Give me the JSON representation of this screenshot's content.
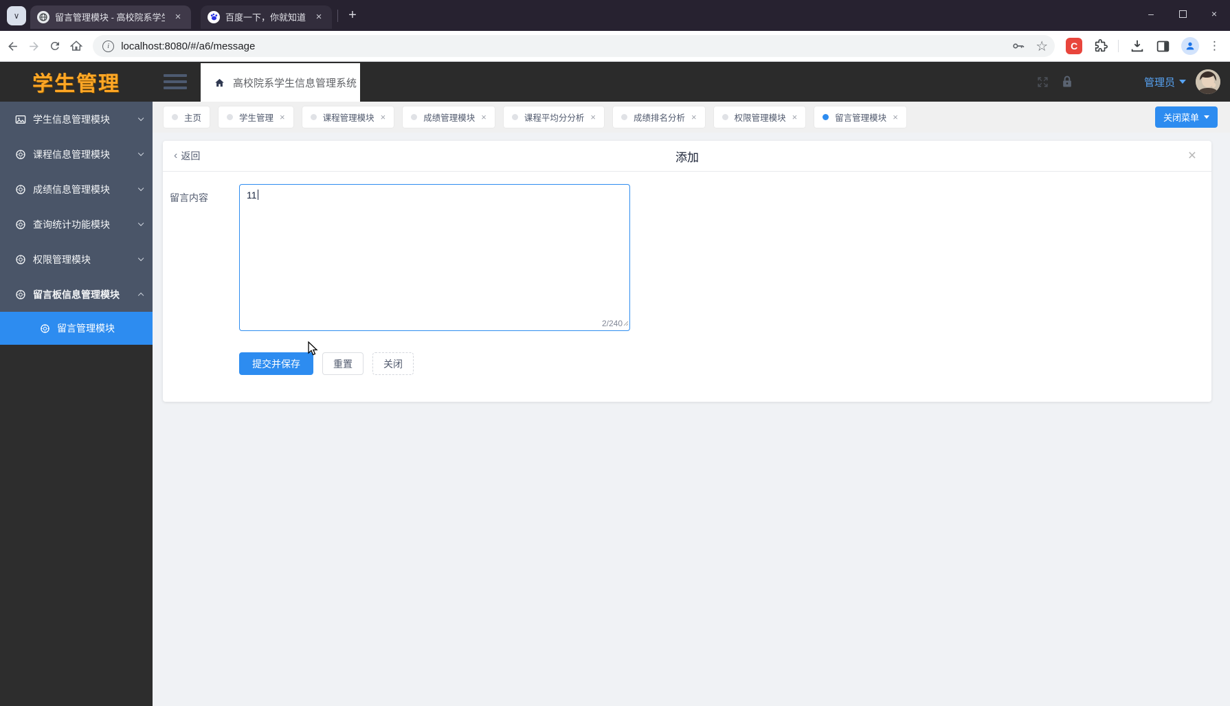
{
  "browser": {
    "tabs": [
      {
        "title": "留言管理模块 - 高校院系学生信",
        "favicon": "globe-icon"
      },
      {
        "title": "百度一下，你就知道",
        "favicon": "baidu-paw-icon"
      }
    ],
    "url": "localhost:8080/#/a6/message"
  },
  "glyphs": {
    "close": "×",
    "plus": "+",
    "minimize": "–",
    "more": "⋮",
    "star": "☆",
    "info": "i",
    "extension_c": "C",
    "back_chevron": "‹",
    "tab_chevron": "∨"
  },
  "header": {
    "logo": "学生管理",
    "breadcrumb": "高校院系学生信息管理系统",
    "user": "管理员"
  },
  "sidebar": {
    "items": [
      {
        "label": "学生信息管理模块",
        "icon": "image-icon",
        "state": "collapsed"
      },
      {
        "label": "课程信息管理模块",
        "icon": "gauge-icon",
        "state": "collapsed"
      },
      {
        "label": "成绩信息管理模块",
        "icon": "gauge-icon",
        "state": "collapsed"
      },
      {
        "label": "查询统计功能模块",
        "icon": "gauge-icon",
        "state": "collapsed"
      },
      {
        "label": "权限管理模块",
        "icon": "gauge-icon",
        "state": "collapsed"
      },
      {
        "label": "留言板信息管理模块",
        "icon": "gauge-icon",
        "state": "expanded"
      }
    ],
    "subitem": {
      "label": "留言管理模块",
      "active": true
    }
  },
  "tags": [
    {
      "label": "主页",
      "closable": false,
      "active": false
    },
    {
      "label": "学生管理",
      "closable": true,
      "active": false
    },
    {
      "label": "课程管理模块",
      "closable": true,
      "active": false
    },
    {
      "label": "成绩管理模块",
      "closable": true,
      "active": false
    },
    {
      "label": "课程平均分分析",
      "closable": true,
      "active": false
    },
    {
      "label": "成绩排名分析",
      "closable": true,
      "active": false
    },
    {
      "label": "权限管理模块",
      "closable": true,
      "active": false
    },
    {
      "label": "留言管理模块",
      "closable": true,
      "active": true
    }
  ],
  "close_menu_label": "关闭菜单",
  "panel": {
    "back_label": "返回",
    "title": "添加",
    "form": {
      "label": "留言内容",
      "value": "11",
      "counter": "2/240"
    },
    "buttons": {
      "submit": "提交并保存",
      "reset": "重置",
      "close": "关闭"
    }
  },
  "colors": {
    "primary": "#2d8cf0",
    "header_bg": "#2b2b2b",
    "sidebar_menu_bg": "#4a5568",
    "sidebar_bg": "#2d2d2d",
    "logo": "#ffa726"
  }
}
